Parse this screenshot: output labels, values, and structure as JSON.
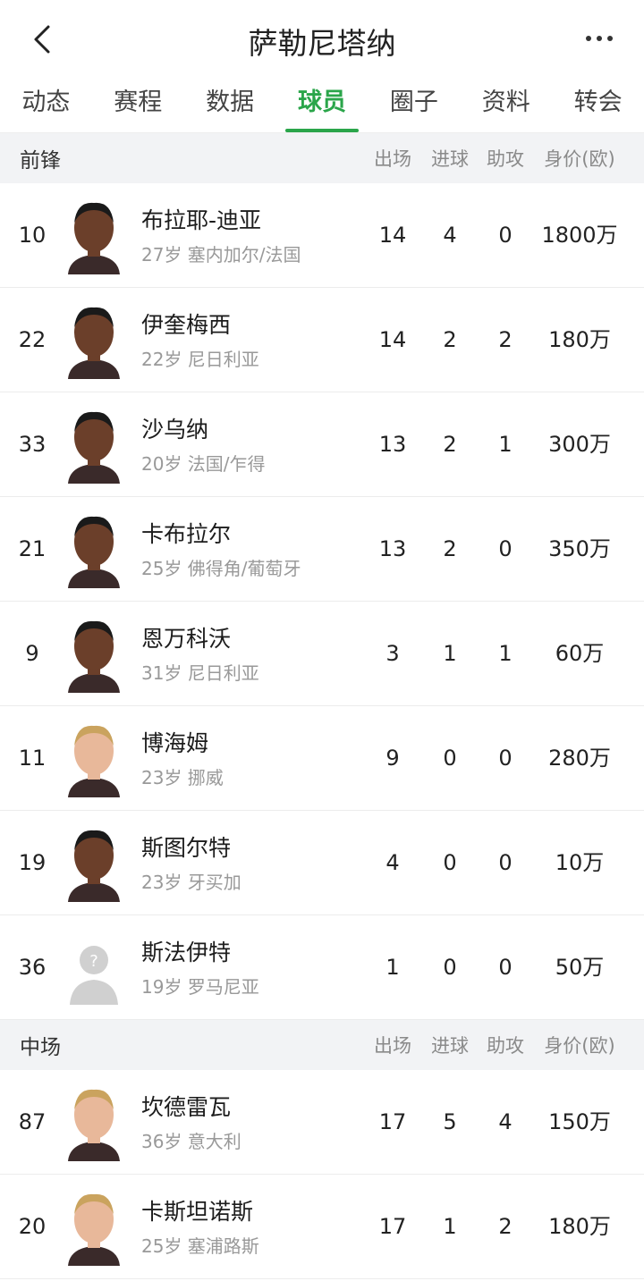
{
  "header": {
    "title": "萨勒尼塔纳"
  },
  "tabs": [
    {
      "label": "动态"
    },
    {
      "label": "赛程"
    },
    {
      "label": "数据"
    },
    {
      "label": "球员"
    },
    {
      "label": "圈子"
    },
    {
      "label": "资料"
    },
    {
      "label": "转会"
    }
  ],
  "active_tab": "球员",
  "accent_color": "#2aa54a",
  "columns": {
    "apps": "出场",
    "goals": "进球",
    "assists": "助攻",
    "value": "身价(欧)"
  },
  "sections": [
    {
      "name": "前锋",
      "players": [
        {
          "number": "10",
          "name": "布拉耶-迪亚",
          "meta": "27岁 塞内加尔/法国",
          "apps": "14",
          "goals": "4",
          "assists": "0",
          "value": "1800万"
        },
        {
          "number": "22",
          "name": "伊奎梅西",
          "meta": "22岁 尼日利亚",
          "apps": "14",
          "goals": "2",
          "assists": "2",
          "value": "180万"
        },
        {
          "number": "33",
          "name": "沙乌纳",
          "meta": "20岁 法国/乍得",
          "apps": "13",
          "goals": "2",
          "assists": "1",
          "value": "300万"
        },
        {
          "number": "21",
          "name": "卡布拉尔",
          "meta": "25岁 佛得角/葡萄牙",
          "apps": "13",
          "goals": "2",
          "assists": "0",
          "value": "350万"
        },
        {
          "number": "9",
          "name": "恩万科沃",
          "meta": "31岁 尼日利亚",
          "apps": "3",
          "goals": "1",
          "assists": "1",
          "value": "60万"
        },
        {
          "number": "11",
          "name": "博海姆",
          "meta": "23岁 挪威",
          "apps": "9",
          "goals": "0",
          "assists": "0",
          "value": "280万"
        },
        {
          "number": "19",
          "name": "斯图尔特",
          "meta": "23岁 牙买加",
          "apps": "4",
          "goals": "0",
          "assists": "0",
          "value": "10万"
        },
        {
          "number": "36",
          "name": "斯法伊特",
          "meta": "19岁 罗马尼亚",
          "apps": "1",
          "goals": "0",
          "assists": "0",
          "value": "50万"
        }
      ]
    },
    {
      "name": "中场",
      "players": [
        {
          "number": "87",
          "name": "坎德雷瓦",
          "meta": "36岁 意大利",
          "apps": "17",
          "goals": "5",
          "assists": "4",
          "value": "150万"
        },
        {
          "number": "20",
          "name": "卡斯坦诺斯",
          "meta": "25岁 塞浦路斯",
          "apps": "17",
          "goals": "1",
          "assists": "2",
          "value": "180万"
        }
      ]
    }
  ]
}
